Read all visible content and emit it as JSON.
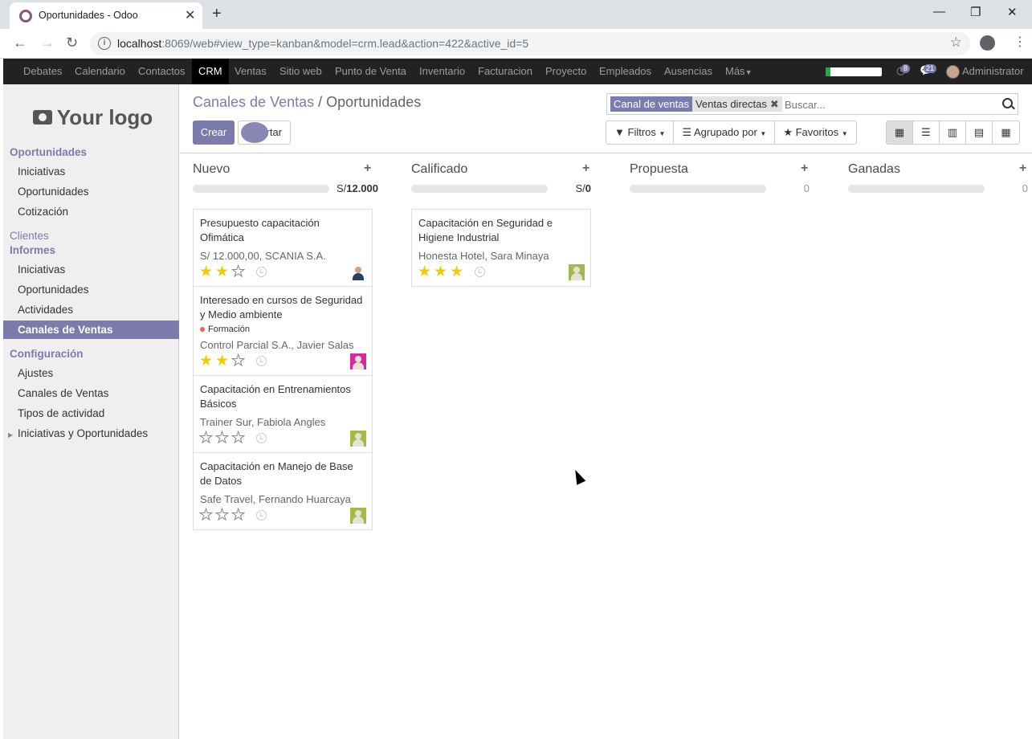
{
  "browser": {
    "tab_title": "Oportunidades - Odoo",
    "url_host": "localhost",
    "url_rest": ":8069/web#view_type=kanban&model=crm.lead&action=422&active_id=5",
    "minimize_glyph": "—",
    "restore_glyph": "❐",
    "close_glyph": "✕"
  },
  "topmenu": {
    "items": [
      "Debates",
      "Calendario",
      "Contactos",
      "CRM",
      "Ventas",
      "Sitio web",
      "Punto de Venta",
      "Inventario",
      "Facturacion",
      "Proyecto",
      "Empleados",
      "Ausencias",
      "Más"
    ],
    "active": "CRM",
    "progress": 0.08,
    "activity_count": "8",
    "message_count": "21",
    "user": "Administrator"
  },
  "sidebar": {
    "logo_text": "Your logo",
    "sections": {
      "oportunidades": "Oportunidades",
      "oportunidades_items": [
        "Iniciativas",
        "Oportunidades",
        "Cotización"
      ],
      "clientes": "Clientes",
      "informes": "Informes",
      "informes_items": [
        "Iniciativas",
        "Oportunidades",
        "Actividades",
        "Canales de Ventas"
      ],
      "configuracion": "Configuración",
      "configuracion_items": [
        "Ajustes",
        "Canales de Ventas",
        "Tipos de actividad",
        "Iniciativas y Oportunidades"
      ]
    }
  },
  "control_panel": {
    "breadcrumb_parent": "Canales de Ventas",
    "breadcrumb_sep": "/",
    "breadcrumb_current": "Oportunidades",
    "create_label": "Crear",
    "import_label": "rtar",
    "facet_label": "Canal de ventas",
    "facet_value": "Ventas directas",
    "search_placeholder": "Buscar...",
    "filters_label": "Filtros",
    "groupby_label": "Agrupado por",
    "favorites_label": "Favoritos"
  },
  "kanban": {
    "columns": [
      {
        "title": "Nuevo",
        "total_prefix": "S/",
        "total": "12.000"
      },
      {
        "title": "Calificado",
        "total_prefix": "S/",
        "total": "0"
      },
      {
        "title": "Propuesta",
        "total": "0"
      },
      {
        "title": "Ganadas",
        "total": "0"
      }
    ],
    "cards": [
      {
        "title": "Presupuesto capacitación Ofimática",
        "info": "S/ 12.000,00, SCANIA S.A.",
        "stars": 2
      },
      {
        "title": "Interesado en cursos de Seguridad y Medio ambiente",
        "tag": "Formación",
        "info": "Control Parcial S.A., Javier Salas",
        "stars": 2
      },
      {
        "title": "Capacitación en Entrenamientos Básicos",
        "info": "Trainer Sur, Fabiola Angles",
        "stars": 0
      },
      {
        "title": "Capacitación en Manejo de Base de Datos",
        "info": "Safe Travel, Fernando Huarcaya",
        "stars": 0
      },
      {
        "title": "Capacitación en Seguridad e Higiene Industrial",
        "info": "Honesta Hotel, Sara Minaya",
        "stars": 3
      }
    ]
  },
  "colors": {
    "accent": "#7c7bad",
    "star_on": "#f3cc00",
    "topbar": "#222222"
  }
}
